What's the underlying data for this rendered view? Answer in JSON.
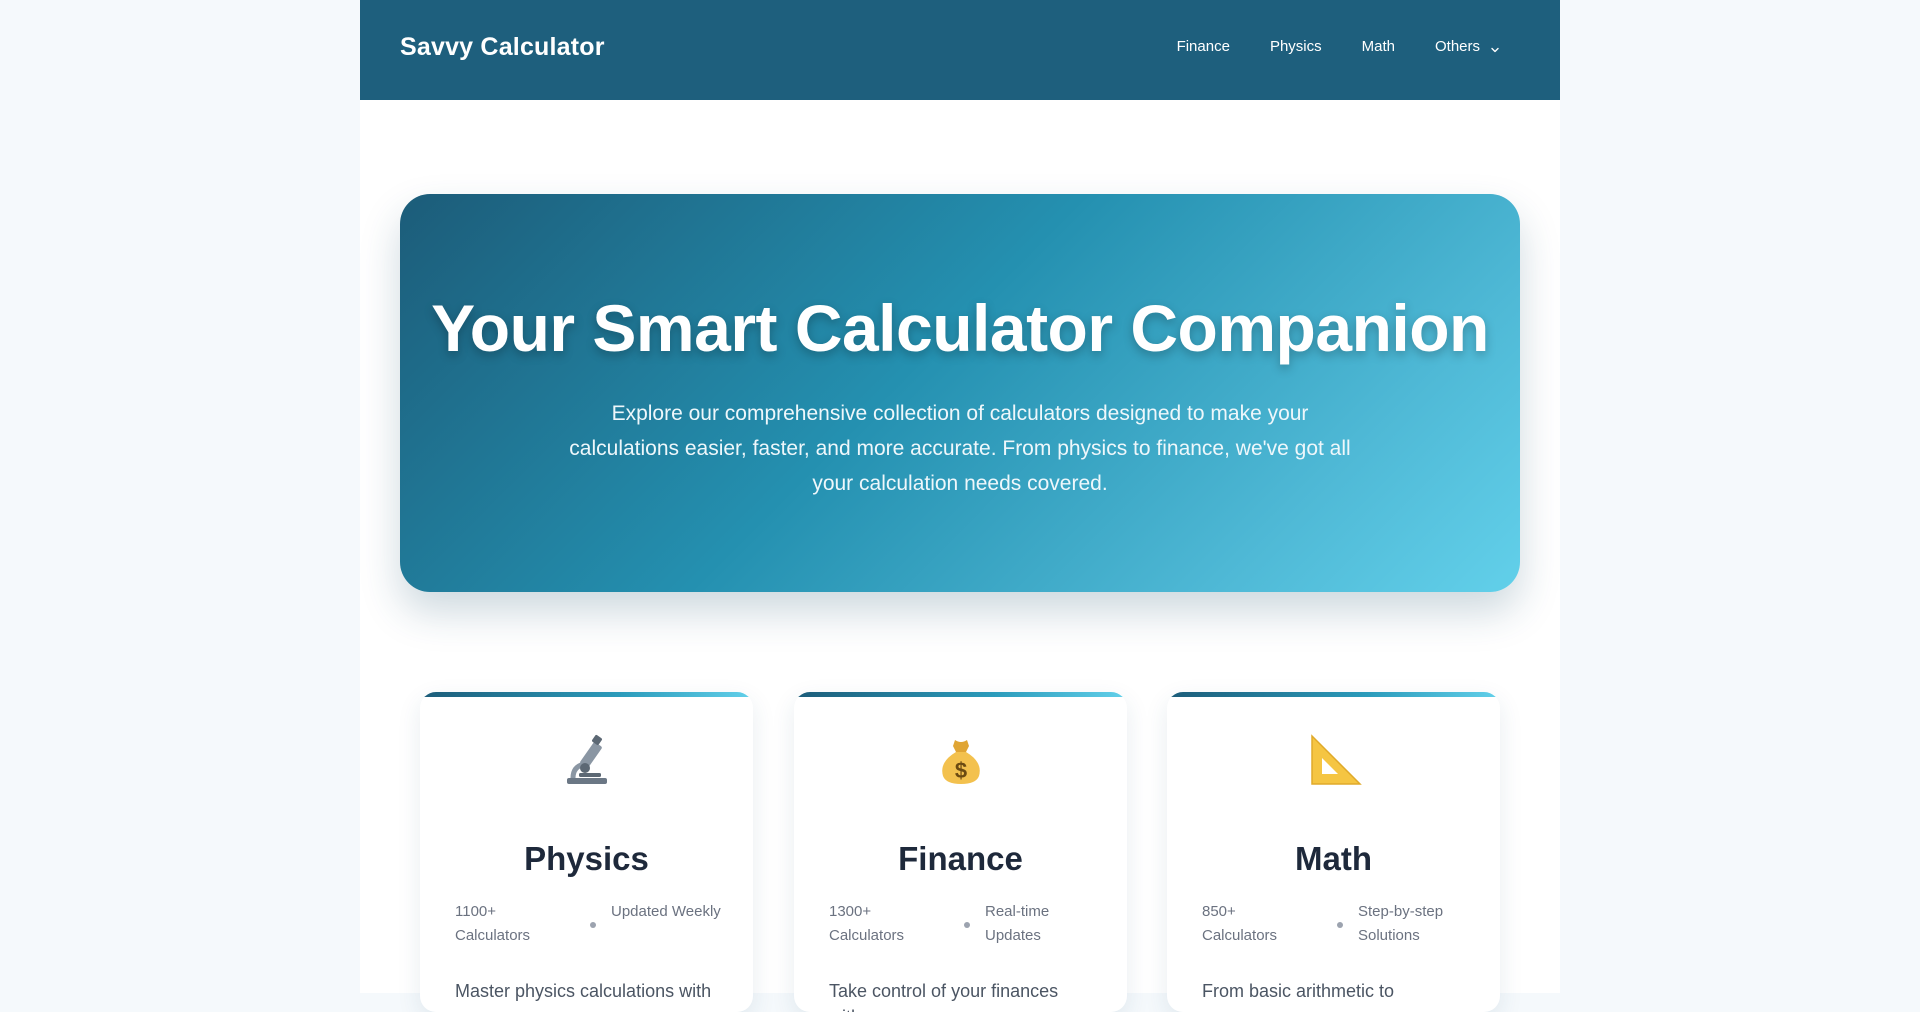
{
  "header": {
    "brand": "Savvy Calculator",
    "nav": [
      "Finance",
      "Physics",
      "Math",
      "Others"
    ]
  },
  "hero": {
    "title": "Your Smart Calculator Companion",
    "text": "Explore our comprehensive collection of calculators designed to make your calculations easier, faster, and more accurate. From physics to finance, we've got all your calculation needs covered."
  },
  "cards": [
    {
      "icon": "microscope-icon",
      "title": "Physics",
      "stat1": "1100+ Calculators",
      "stat2": "Updated Weekly",
      "desc": "Master physics calculations with"
    },
    {
      "icon": "money-bag-icon",
      "title": "Finance",
      "stat1": "1300+ Calculators",
      "stat2": "Real-time Updates",
      "desc": "Take control of your finances with"
    },
    {
      "icon": "triangular-ruler-icon",
      "title": "Math",
      "stat1": "850+ Calculators",
      "stat2": "Step-by-step Solutions",
      "desc": "From basic arithmetic to"
    }
  ],
  "colors": {
    "header_bg": "#1e5f7d",
    "hero_gradient_start": "#1c5c79",
    "hero_gradient_end": "#62d0ea",
    "page_bg": "#f5f9fc"
  }
}
